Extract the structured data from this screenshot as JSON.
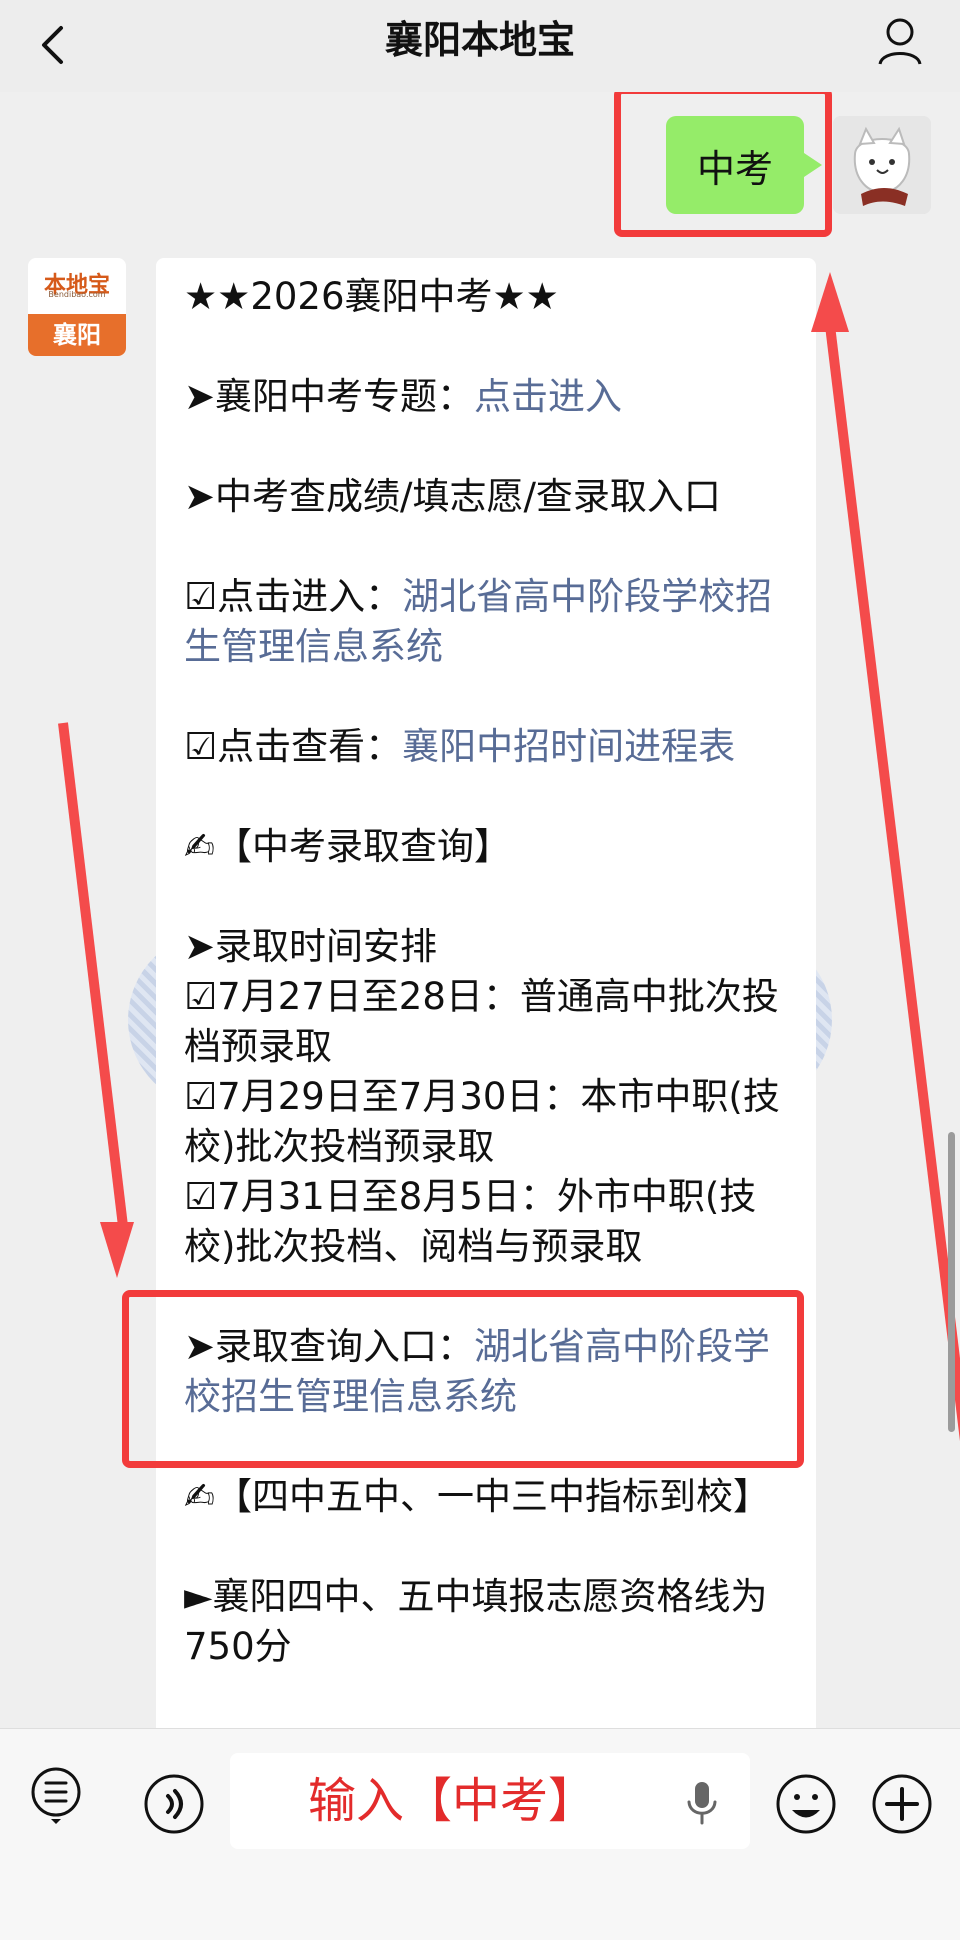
{
  "header": {
    "title": "襄阳本地宝"
  },
  "chat": {
    "user_message": "中考",
    "bot": {
      "avatar_logo_top": "本地宝",
      "avatar_logo_url": "Bendibao.com",
      "avatar_logo_bottom": "襄阳",
      "lines": [
        "★★2026襄阳中考★★",
        "➤襄阳中考专题：",
        "点击进入",
        "➤中考查成绩/填志愿/查录取入口",
        "☑点击进入：",
        "湖北省高中阶段学校招生管理信息系统",
        "☑点击查看：",
        "襄阳中招时间进程表",
        "✍【中考录取查询】",
        "➤录取时间安排",
        "☑7月27日至28日：普通高中批次投档预录取",
        "☑7月29日至7月30日：本市中职(技校)批次投档预录取",
        "☑7月31日至8月5日：外市中职(技校)批次投档、阅档与预录取",
        "➤录取查询入口：",
        "湖北省高中阶段学校招生管理信息系统",
        "✍【四中五中、一中三中指标到校】",
        "►襄阳四中、五中填报志愿资格线为750分"
      ]
    }
  },
  "input_bar": {
    "placeholder": "输入【中考】"
  },
  "colors": {
    "bubble_green": "#95ec69",
    "link_blue": "#586c96",
    "highlight_red": "#f23b3b",
    "brand_orange": "#e76f2b"
  },
  "icons": [
    "back-icon",
    "profile-icon",
    "menu-list-icon",
    "voice-icon",
    "mic-icon",
    "emoji-icon",
    "plus-icon"
  ]
}
